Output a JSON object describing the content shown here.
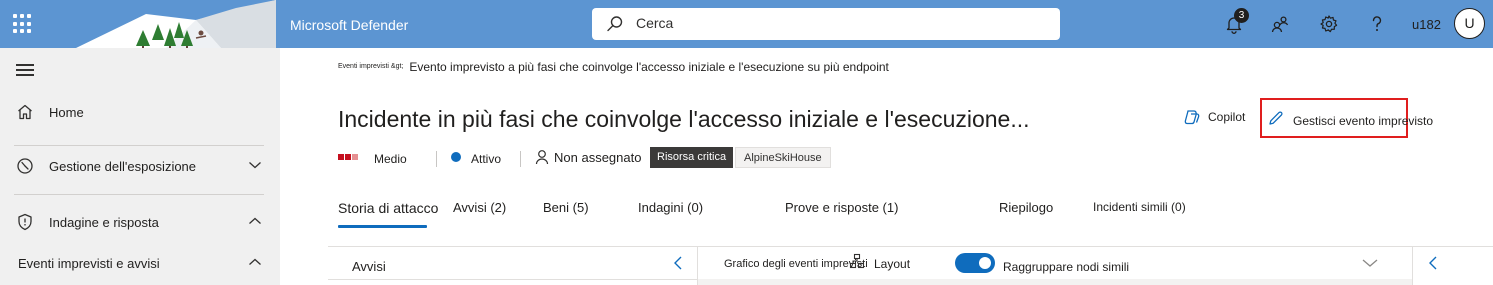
{
  "topbar": {
    "app_title": "Microsoft Defender",
    "search_placeholder": "Cerca",
    "notification_count": "3",
    "user_name": "u182",
    "avatar_initial": "U",
    "icons": [
      "waffle-icon",
      "search-icon",
      "bell-icon",
      "people-icon",
      "gear-icon",
      "help-icon"
    ],
    "colors": {
      "bar": "#5c95d2"
    }
  },
  "sidebar": {
    "items": [
      {
        "label": "Home",
        "icon": "home-icon"
      },
      {
        "label": "Gestione dell'esposizione",
        "icon": "gauge-icon",
        "expanded": false
      },
      {
        "label": "Indagine e risposta",
        "icon": "shield-icon",
        "expanded": true
      }
    ],
    "sub_item": "Eventi imprevisti e avvisi"
  },
  "main": {
    "breadcrumb": {
      "parent": "Eventi imprevisti &gt;",
      "current": "Evento imprevisto a più fasi che coinvolge l'accesso iniziale e l'esecuzione su più endpoint"
    },
    "title": "Incidente in più fasi che coinvolge l'accesso iniziale e l'esecuzione...",
    "actions": {
      "copilot": "Copilot",
      "manage": "Gestisci evento imprevisto"
    },
    "meta": {
      "severity": "Medio",
      "status": "Attivo",
      "assignee": "Non assegnato",
      "tag_critical": "Risorsa critica",
      "tag_org": "AlpineSkiHouse",
      "colors": {
        "severity": "#c50f1f",
        "status": "#0f6cbd"
      }
    },
    "tabs": [
      "Storia di attacco",
      "Avvisi (2)",
      "Beni (5)",
      "Indagini (0)",
      "Prove e risposte (1)",
      "Riepilogo",
      "Incidenti simili (0)"
    ],
    "active_tab": "Storia di attacco",
    "panels": {
      "alerts_title": "Avvisi",
      "graph_title": "Grafico degli eventi imprevisti",
      "layout_label": "Layout",
      "group_label": "Raggruppare nodi simili",
      "group_enabled": true
    }
  }
}
